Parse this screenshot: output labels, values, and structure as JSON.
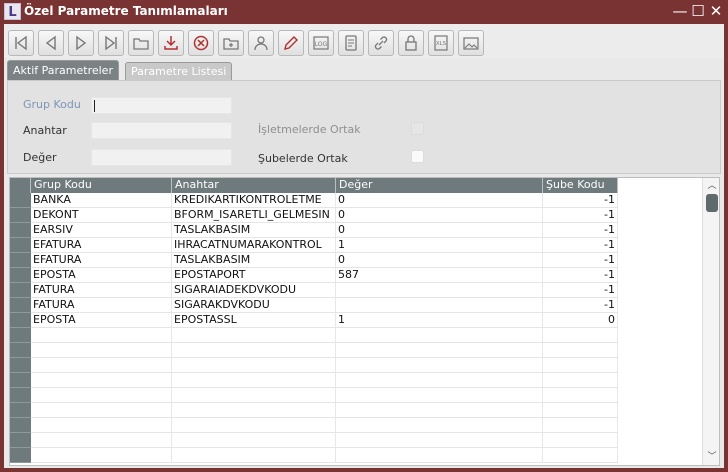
{
  "window": {
    "logo": "L",
    "title": "Özel Parametre Tanımlamaları",
    "minimize": "—",
    "maximize": "☐",
    "close": "✕"
  },
  "toolbar": {
    "buttons": [
      {
        "name": "first-record-icon"
      },
      {
        "name": "previous-record-icon"
      },
      {
        "name": "next-record-icon"
      },
      {
        "name": "last-record-icon"
      },
      {
        "name": "open-folder-icon"
      },
      {
        "name": "download-icon"
      },
      {
        "name": "cancel-icon"
      },
      {
        "name": "new-folder-icon"
      },
      {
        "name": "user-icon"
      },
      {
        "name": "edit-pencil-icon"
      },
      {
        "name": "log-icon",
        "text": "LOG"
      },
      {
        "name": "document-icon"
      },
      {
        "name": "link-icon"
      },
      {
        "name": "lock-icon"
      },
      {
        "name": "xls-icon",
        "text": "XLS"
      },
      {
        "name": "image-icon"
      }
    ]
  },
  "tabs": [
    {
      "label": "Aktif Parametreler",
      "active": true
    },
    {
      "label": "Parametre Listesi",
      "active": false
    }
  ],
  "form": {
    "grup_kodu_label": "Grup Kodu",
    "grup_kodu_value": "",
    "anahtar_label": "Anahtar",
    "anahtar_value": "",
    "deger_label": "Değer",
    "deger_value": "",
    "isletmelerde_ortak_label": "İşletmelerde Ortak",
    "isletmelerde_ortak_checked": false,
    "subelerde_ortak_label": "Şubelerde Ortak",
    "subelerde_ortak_checked": false
  },
  "grid": {
    "columns": [
      "Grup Kodu",
      "Anahtar",
      "Değer",
      "Şube Kodu"
    ],
    "rows": [
      [
        "BANKA",
        "KREDIKARTIKONTROLETME",
        "0",
        "-1"
      ],
      [
        "DEKONT",
        "BFORM_ISARETLI_GELMESIN",
        "0",
        "-1"
      ],
      [
        "EARSIV",
        "TASLAKBASIM",
        "0",
        "-1"
      ],
      [
        "EFATURA",
        "IHRACATNUMARAKONTROL",
        "1",
        "-1"
      ],
      [
        "EFATURA",
        "TASLAKBASIM",
        "0",
        "-1"
      ],
      [
        "EPOSTA",
        "EPOSTAPORT",
        "587",
        "-1"
      ],
      [
        "FATURA",
        "SIGARAIADEKDVKODU",
        "",
        "-1"
      ],
      [
        "FATURA",
        "SIGARAKDVKODU",
        "",
        "-1"
      ],
      [
        "EPOSTA",
        "EPOSTASSL",
        "1",
        "0"
      ]
    ],
    "empty_rows": 9
  }
}
